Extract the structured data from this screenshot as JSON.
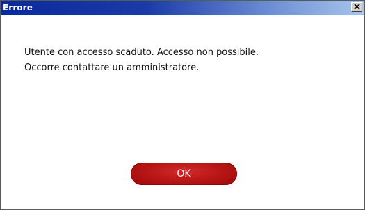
{
  "dialog": {
    "title": "Errore",
    "close_icon": "close-icon",
    "message_lines": [
      "Utente con accesso scaduto. Accesso non possibile.",
      "Occorre contattare un amministratore."
    ],
    "ok_label": "OK"
  },
  "colors": {
    "titlebar_start": "#0a2a9c",
    "titlebar_end": "#a8c4ec",
    "button_red": "#b51414",
    "text": "#111111"
  }
}
